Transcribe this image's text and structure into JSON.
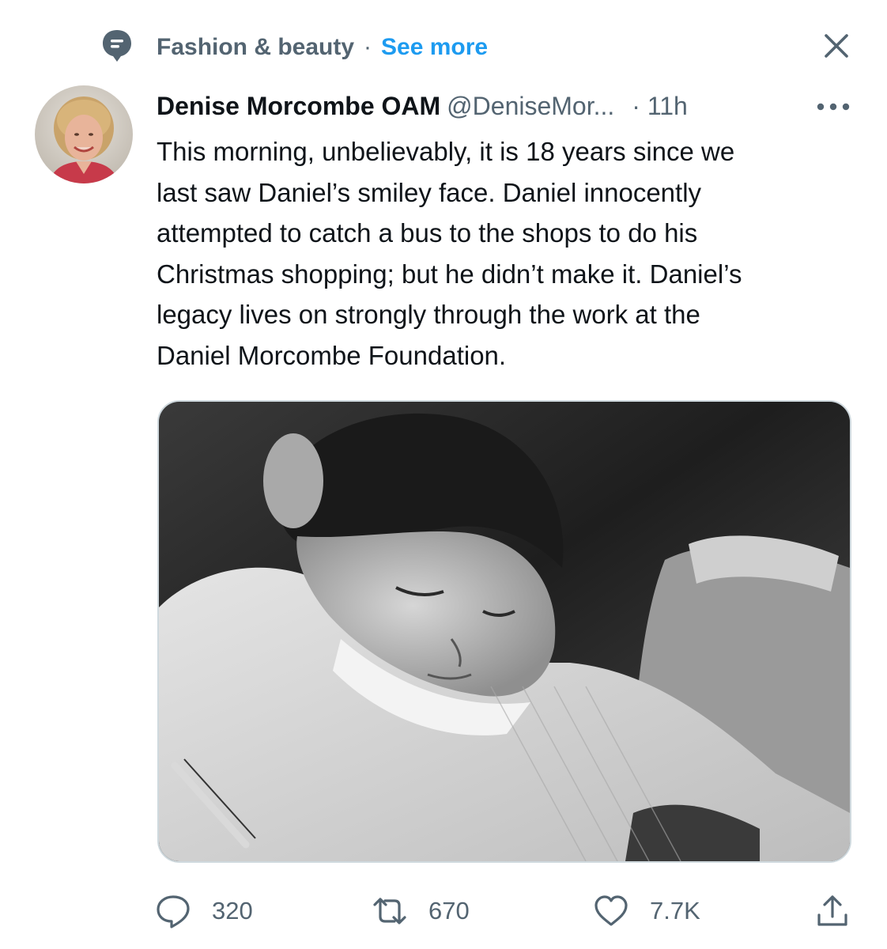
{
  "context": {
    "topic_label": "Fashion & beauty",
    "separator": "·",
    "see_more_label": "See more"
  },
  "tweet": {
    "author_name": "Denise Morcombe OAM",
    "author_handle": "@DeniseMor...",
    "time": "· 11h",
    "text_lines": [
      "This morning, unbelievably, it is 18 years since we",
      "last saw Daniel’s smiley face. Daniel innocently",
      "attempted to catch a bus to the shops to do his",
      "Christmas shopping; but he didn’t make it. Daniel’s",
      "legacy lives on strongly through the work at the",
      "Daniel Morcombe Foundation."
    ]
  },
  "actions": {
    "replies": "320",
    "retweets": "670",
    "likes": "7.7K"
  },
  "colors": {
    "accent": "#1d9bf0",
    "secondary_text": "#536471",
    "primary_text": "#0f1419",
    "border": "#cfd9de"
  },
  "icons": {
    "topic": "topic-bubble-icon",
    "close": "close-icon",
    "more": "more-icon",
    "reply": "reply-icon",
    "retweet": "retweet-icon",
    "like": "heart-icon",
    "share": "share-icon"
  }
}
